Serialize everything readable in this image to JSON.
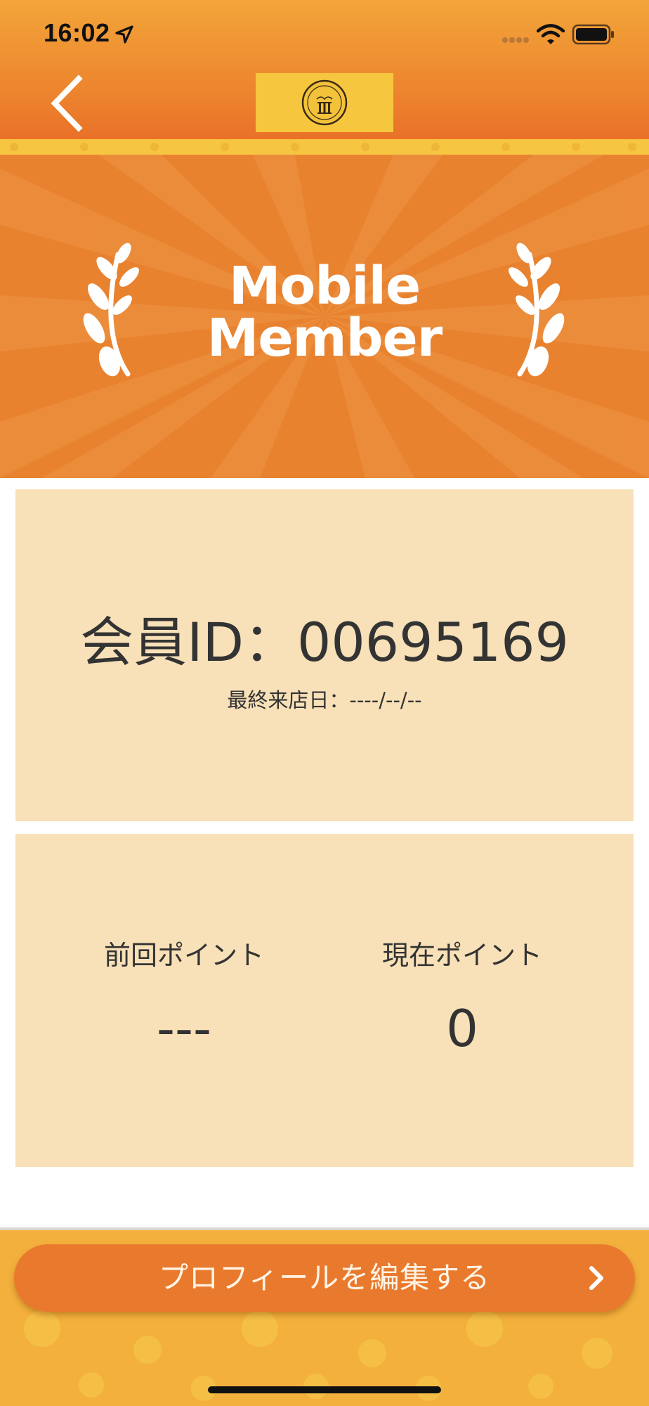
{
  "status_bar": {
    "time": "16:02",
    "icons": [
      "location-arrow-icon",
      "cellular-signal-icon",
      "wifi-icon",
      "battery-icon"
    ]
  },
  "nav": {
    "back_icon": "chevron-left-icon",
    "logo_icon": "shop-logo-icon"
  },
  "banner": {
    "title_line1": "Mobile",
    "title_line2": "Member",
    "decoration_icons": [
      "laurel-left-icon",
      "laurel-right-icon"
    ]
  },
  "member_card": {
    "id_label": "会員ID：",
    "id_value": "00695169",
    "last_visit_label": "最終来店日：",
    "last_visit_value": "----/--/--"
  },
  "points_card": {
    "previous_label": "前回ポイント",
    "previous_value": "---",
    "current_label": "現在ポイント",
    "current_value": "0"
  },
  "footer": {
    "edit_profile_label": "プロフィールを編集する",
    "edit_profile_icon": "chevron-right-icon"
  },
  "colors": {
    "header_orange": "#EE8A30",
    "banner_orange": "#E8822F",
    "card_beige": "#F8E1B8",
    "button_orange": "#E97A2D",
    "footer_gold": "#F3B03C"
  }
}
